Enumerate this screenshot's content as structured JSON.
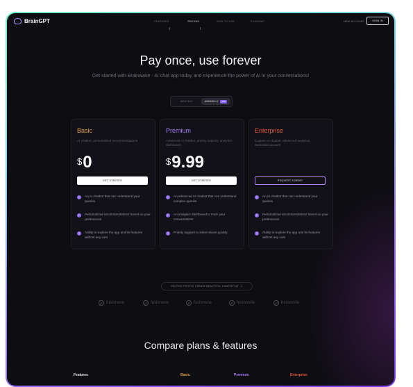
{
  "header": {
    "brand": "BrainGPT",
    "nav": [
      {
        "label": "FEATURES",
        "active": false
      },
      {
        "label": "PRICING",
        "active": true
      },
      {
        "label": "HOW TO USE",
        "active": false
      },
      {
        "label": "ROADMAP",
        "active": false
      }
    ],
    "new_account": "NEW ACCOUNT",
    "sign_in": "SIGN IN"
  },
  "hero": {
    "title": "Pay once, use forever",
    "subtitle": "Get started with Brainwave - AI chat app today and experience the power of AI in your conversations!"
  },
  "billing_toggle": {
    "monthly": "MONTHLY",
    "annually": "ANNUALLY",
    "badge": "-10%",
    "selected": "annually"
  },
  "plans": [
    {
      "name": "Basic",
      "color": "#e0a23c",
      "description": "AI chatbot, personalized recommendations",
      "currency": "$",
      "price": "0",
      "button": "GET STARTED",
      "button_style": "white",
      "features": [
        "An AI chatbot that can understand your queries",
        "Personalized recommendations based on your preferences",
        "Ability to explore the app and its features without any cost"
      ]
    },
    {
      "name": "Premium",
      "color": "#a77cf6",
      "description": "Advanced AI chatbot, priority support, analytics dashboard",
      "currency": "$",
      "price": "9.99",
      "button": "GET STARTED",
      "button_style": "white",
      "features": [
        "An advanced AI chatbot that can understand complex queries",
        "An analytics dashboard to track your conversations",
        "Priority support to solve issues quickly"
      ]
    },
    {
      "name": "Enterprise",
      "color": "#e35a3a",
      "description": "Custom AI chatbot, advanced analytics, dedicated account",
      "currency": "",
      "price": "",
      "button": "REQUEST A DEMO",
      "button_style": "outline",
      "features": [
        "An AI chatbot that can understand your queries",
        "Personalized recommendations based on your preferences",
        "Ability to explore the app and its features without any cost"
      ]
    }
  ],
  "social_proof": {
    "text": "HELPING PEOPLE CREATE BEAUTIFUL CONTENT AT",
    "logos": [
      "fusionone",
      "fusionone",
      "fusionone",
      "fusionone",
      "fusionone"
    ]
  },
  "compare": {
    "title": "Compare plans & features",
    "headers": [
      "Features",
      "Basic",
      "Premium",
      "Enterprise"
    ]
  }
}
